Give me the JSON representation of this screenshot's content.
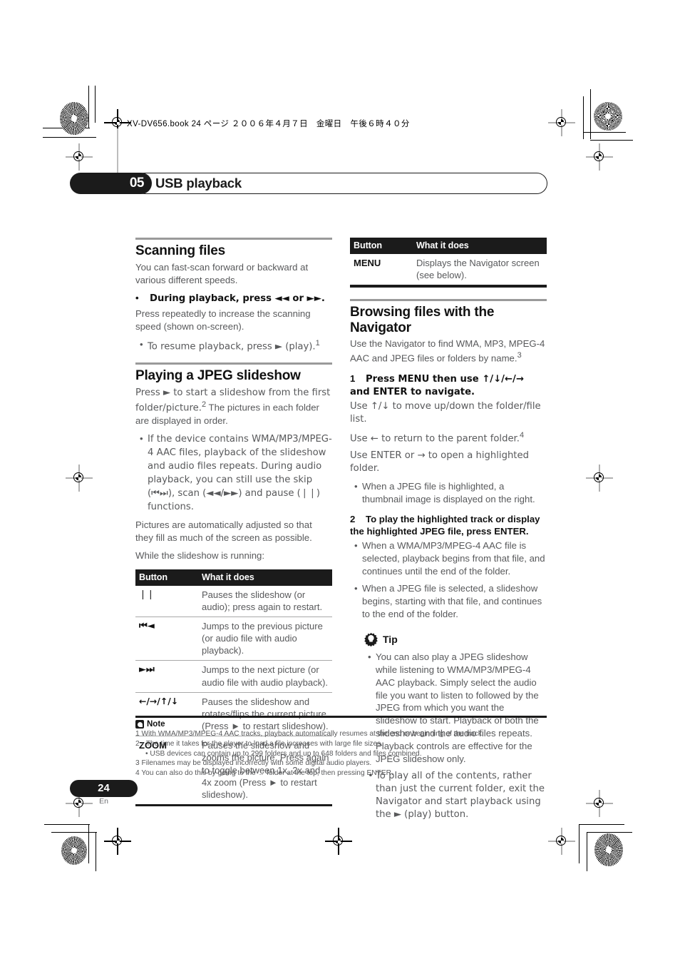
{
  "print_header": {
    "filename_line": "XV-DV656.book  24 ページ  ２００６年４月７日　金曜日　午後６時４０分"
  },
  "chapter": {
    "number": "05",
    "title": "USB playback"
  },
  "left_column": {
    "section_scanning": {
      "heading": "Scanning files",
      "intro": "You can fast-scan forward or backward at various different speeds.",
      "bold_bullet": "During playback, press ◄◄ or ►►.",
      "after_bold": "Press repeatedly to increase the scanning speed (shown on-screen).",
      "sub_bullet": "To resume playback, press ► (play).",
      "sub_bullet_note_ref": "1"
    },
    "section_slideshow": {
      "heading": "Playing a JPEG slideshow",
      "intro_a": "Press ► to start a slideshow from the first folder/picture.",
      "intro_note_ref": "2",
      "intro_b": "The pictures in each folder are displayed in order.",
      "bullet_1": "If the device contains WMA/MP3/MPEG-4 AAC files, playback of the slideshow and audio files repeats. During audio playback, you can still use the skip (⏮⏭), scan (◄◄/►►) and pause (❘❘) functions.",
      "para_after": "Pictures are automatically adjusted so that they fill as much of the screen as possible.",
      "para_running": "While the slideshow is running:"
    },
    "table": {
      "headers": [
        "Button",
        "What it does"
      ],
      "rows": [
        {
          "button": "❘❘",
          "desc": "Pauses the slideshow (or audio); press again to restart."
        },
        {
          "button": "⏮◄",
          "desc": "Jumps to the previous picture (or audio file with audio playback)."
        },
        {
          "button": "►⏭",
          "desc": "Jumps to the next picture (or audio file with audio playback)."
        },
        {
          "button": "←/→/↑/↓",
          "desc": "Pauses the slideshow and rotates/flips the current picture (Press ► to restart slideshow)."
        },
        {
          "button": "ZOOM",
          "desc": "Pauses the slideshow and zooms the picture. Press again to toggle between 1x, 2x and 4x zoom (Press ► to restart slideshow)."
        }
      ]
    }
  },
  "right_column": {
    "table": {
      "headers": [
        "Button",
        "What it does"
      ],
      "rows": [
        {
          "button": "MENU",
          "desc": "Displays the Navigator screen (see below)."
        }
      ]
    },
    "section_navigator": {
      "heading": "Browsing files with the Navigator",
      "intro": "Use the Navigator to find WMA, MP3, MPEG-4 AAC and JPEG files or folders by name.",
      "intro_note_ref": "3",
      "step1_num": "1",
      "step1_text": "Press MENU then use ↑/↓/←/→ and ENTER to navigate.",
      "step1_line1": "Use ↑/↓ to move up/down the folder/file list.",
      "step1_line2": "Use ← to return to the parent folder.",
      "step1_line2_note_ref": "4",
      "step1_line3": "Use ENTER or → to open a highlighted folder.",
      "step1_bullet": "When a JPEG file is highlighted, a thumbnail image is displayed on the right.",
      "step2_num": "2",
      "step2_text": "To play the highlighted track or display the highlighted JPEG file, press ENTER.",
      "step2_bullets": [
        "When a WMA/MP3/MPEG-4 AAC file is selected, playback begins from that file, and continues until the end of the folder.",
        "When a JPEG file is selected, a slideshow begins, starting with that file, and continues to the end of the folder."
      ]
    },
    "tip": {
      "label": "Tip",
      "bullets": [
        "You can also play a JPEG slideshow while listening to WMA/MP3/MPEG-4 AAC playback. Simply select the audio file you want to listen to followed by the JPEG from which you want the slideshow to start. Playback of both the slideshow and the audio files repeats. Playback controls are effective for the JPEG slideshow only.",
        "To play all of the contents, rather than just the current folder, exit the Navigator and start playback using the ► (play) button."
      ]
    }
  },
  "notes": {
    "label": "Note",
    "items": [
      {
        "num": "1",
        "text": "With WMA/MP3/MPEG-4 AAC tracks, playback automatically resumes at the end or beginning of the track.",
        "sub": false
      },
      {
        "num": "2",
        "text": "• The time it takes for the player to load a file increases with large file sizes.",
        "sub": false
      },
      {
        "num": "",
        "text": "• USB devices can contain up to 299 folders and up to 648 folders and files combined.",
        "sub": true
      },
      {
        "num": "3",
        "text": "Filenames may be displayed incorrectly with some digital audio players.",
        "sub": false
      },
      {
        "num": "4",
        "text": "You can also do this by going to the '..' folder at the top, then pressing ENTER.",
        "sub": false
      }
    ]
  },
  "footer": {
    "page_number": "24",
    "language": "En"
  },
  "colors": {
    "ink": "#1b1b1b",
    "body_text": "#58595b",
    "rule_gray": "#9a9a9a"
  }
}
